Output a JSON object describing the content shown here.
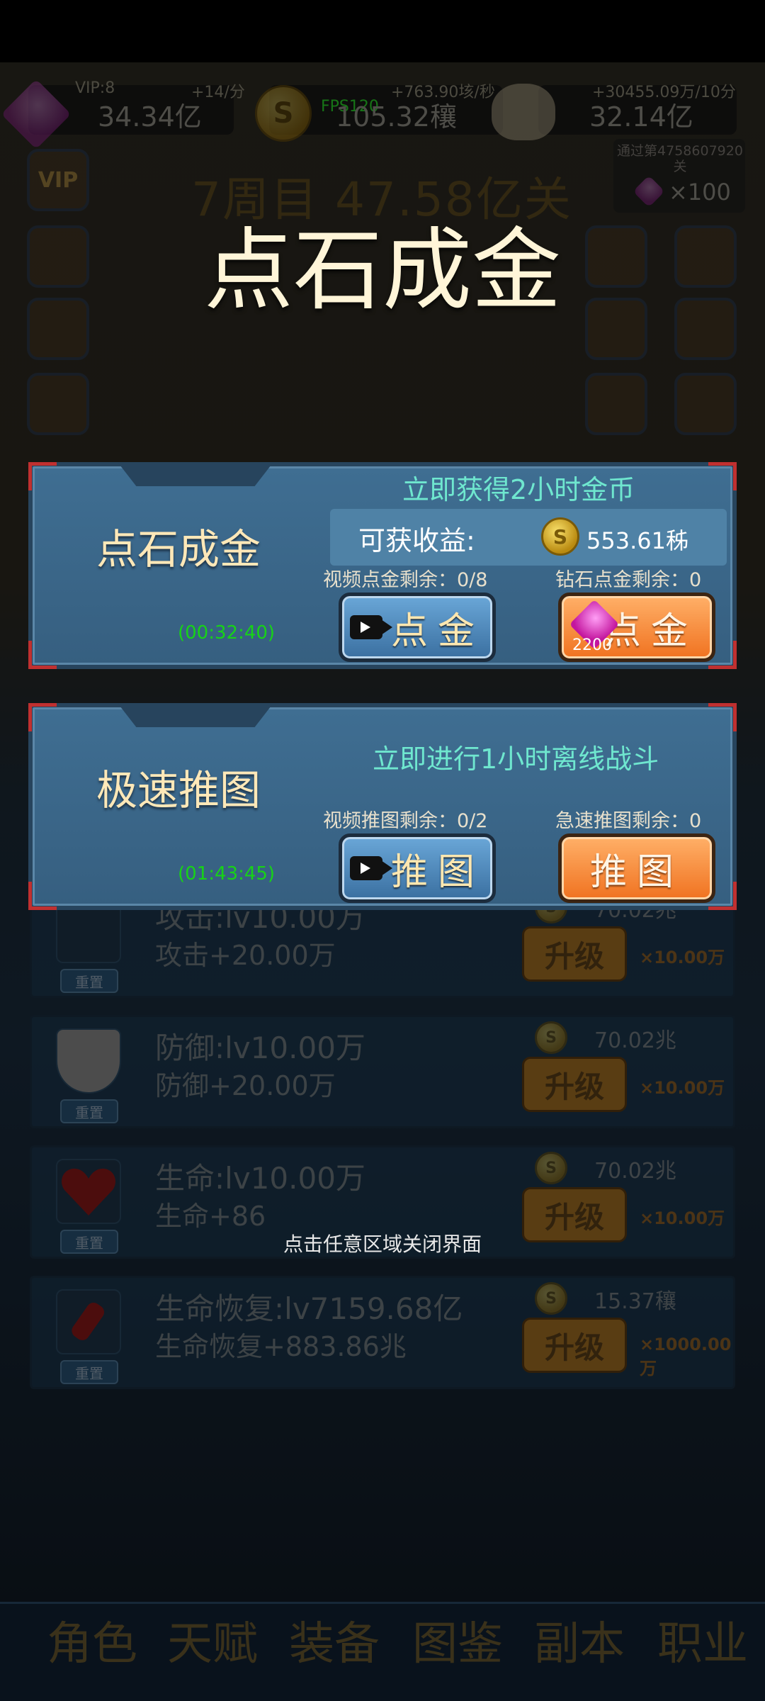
{
  "hud": {
    "vip_label": "VIP:8",
    "gem_rate": "+14/分",
    "gem_total": "34.34亿",
    "fps": "FPS120",
    "coin_rate": "+763.90垓/秒",
    "coin_total": "105.32穰",
    "skull_rate": "+30455.09万/10分",
    "skull_total": "32.14亿"
  },
  "stage": {
    "text": "7周目 47.58亿关"
  },
  "pass_reward": {
    "label": "通过第4758607920关",
    "gem_count": "×100"
  },
  "side_buttons": {
    "vip": "VIP"
  },
  "overlay_title": "点石成金",
  "panel_gold": {
    "title": "点石成金",
    "subtitle": "立即获得2小时金币",
    "income_label": "可获收益:",
    "income_value": "553.61秭",
    "video_remaining": "视频点金剩余：0/8",
    "diamond_remaining": "钻石点金剩余：0",
    "timer": "(00:32:40)",
    "video_button": "点金",
    "diamond_button": "点金",
    "diamond_cost": "2200"
  },
  "panel_push": {
    "title": "极速推图",
    "subtitle": "立即进行1小时离线战斗",
    "video_remaining": "视频推图剩余：0/2",
    "fast_remaining": "急速推图剩余：0",
    "timer": "(01:43:45)",
    "video_button": "推图",
    "fast_button": "推图"
  },
  "upgrades": [
    {
      "name": "攻击:lv10.00万",
      "bonus": "攻击+20.00万",
      "cost": "70.02兆",
      "button": "升级",
      "mult": "×10.00万",
      "reset": "重置",
      "icon": "sword-icon"
    },
    {
      "name": "防御:lv10.00万",
      "bonus": "防御+20.00万",
      "cost": "70.02兆",
      "button": "升级",
      "mult": "×10.00万",
      "reset": "重置",
      "icon": "shield-icon"
    },
    {
      "name": "生命:lv10.00万",
      "bonus": "生命+86",
      "cost": "70.02兆",
      "button": "升级",
      "mult": "×10.00万",
      "reset": "重置",
      "icon": "heart-icon"
    },
    {
      "name": "生命恢复:lv7159.68亿",
      "bonus": "生命恢复+883.86兆",
      "cost": "15.37穰",
      "button": "升级",
      "mult": "×1000.00万",
      "reset": "重置",
      "icon": "potion-icon"
    }
  ],
  "close_hint": "点击任意区域关闭界面",
  "bottom_nav": [
    "角色",
    "天赋",
    "装备",
    "图鉴",
    "副本",
    "职业"
  ],
  "colors": {
    "panel_bg": "#3f6e92",
    "subtitle": "#6fe7cf",
    "timer": "#17d317",
    "orange_button": "#f07220"
  }
}
